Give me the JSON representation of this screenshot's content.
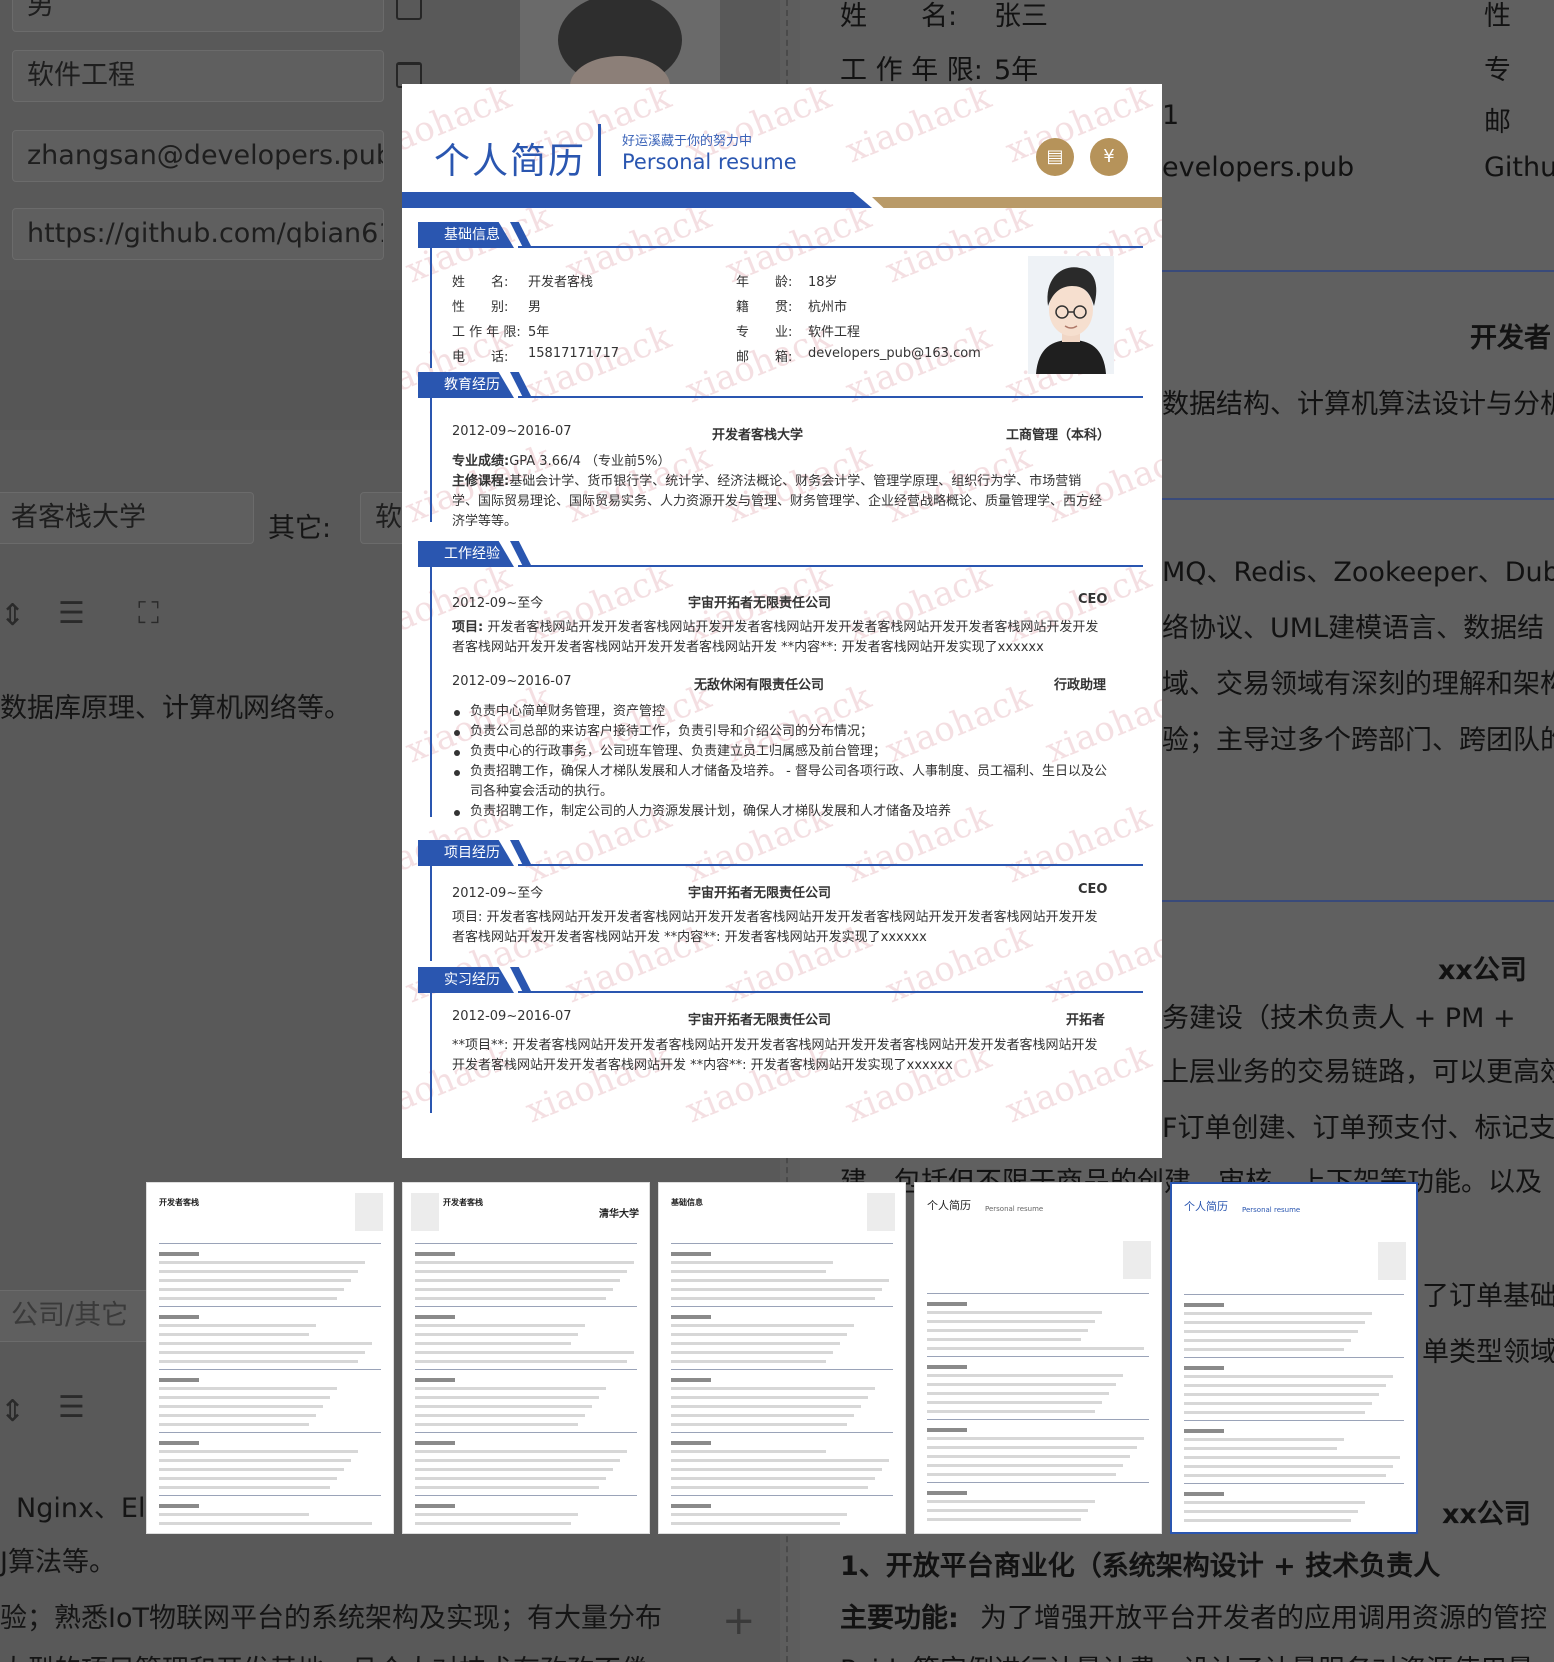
{
  "left_form": {
    "fields": [
      {
        "value": "男"
      },
      {
        "value": "软件工程"
      },
      {
        "value": "zhangsan@developers.pub"
      },
      {
        "value": "https://github.com/qbian61"
      }
    ],
    "school_value": "者客栈大学",
    "other_label": "其它:",
    "other_value": "软",
    "text_1": "数据库原理、计算机网络等。",
    "placeholder_company": "公司/其它",
    "text_2": "Nginx、Ela",
    "text_3": "J算法等。",
    "text_4": "验；熟悉IoT物联网平台的系统架构及实现；有大量分布",
    "text_5": "大型的项目管理和开发基地，且个人对技术有孜孜不倦",
    "plus": "+"
  },
  "right_preview": {
    "name_label": "姓　　名:",
    "name_value": "张三",
    "years_label": "工 作 年 限:",
    "years_value": "5年",
    "gender_label": "性",
    "major_label": "专",
    "email_label": "邮",
    "github_label": "Githu",
    "digit": "1",
    "email_value": "evelopers.pub",
    "heading": "开发者",
    "skill_1": "数据结构、计算机算法设计与分析",
    "skill_2": "MQ、Redis、Zookeeper、Dub",
    "skill_3": "络协议、UML建模语言、数据结",
    "skill_4": "域、交易领域有深刻的理解和架构",
    "skill_5": "验；主导过多个跨部门、跨团队的",
    "company_1": "xx公司",
    "proj_1": "务建设（技术负责人 + PM +",
    "proj_1_d1": "上层业务的交易链路，可以更高效",
    "proj_1_d2": "F订单创建、订单预支付、标记支",
    "proj_1_d3": "建，包括但不限于商品的创建、审核、上下架等功能。以及",
    "proj_1_d4": "了订单基础",
    "proj_1_d5": "单类型领域",
    "company_2": "xx公司",
    "proj_2": "1、开放平台商业化（系统架构设计 + 技术负责人",
    "proj_2_label": "主要功能:",
    "proj_2_d1": "为了增强开放平台开发者的应用调用资源的管控",
    "proj_2_d2": "Paide等实例进行计量计费，设计了计量服务对资源使用量"
  },
  "resume": {
    "title": "个人简历",
    "slogan": "好运溪藏于你的努力中",
    "subtitle": "Personal resume",
    "icons": [
      "save-icon",
      "coin-icon"
    ],
    "watermark": "xiaohack",
    "colors": {
      "accent": "#2a56b0",
      "gold": "#b99a68"
    },
    "basic": {
      "section": "基础信息",
      "rows": [
        {
          "l1": "姓　　名:",
          "v1": "开发者客栈",
          "l2": "年　　龄:",
          "v2": "18岁"
        },
        {
          "l1": "性　　别:",
          "v1": "男",
          "l2": "籍　　贯:",
          "v2": "杭州市"
        },
        {
          "l1": "工 作 年 限:",
          "v1": "5年",
          "l2": "专　　业:",
          "v2": "软件工程"
        },
        {
          "l1": "电　　话:",
          "v1": "15817171717",
          "l2": "邮　　箱:",
          "v2": "developers_pub@163.com"
        }
      ]
    },
    "education": {
      "section": "教育经历",
      "date": "2012-09~2016-07",
      "school": "开发者客栈大学",
      "major": "工商管理（本科）",
      "gpa_label": "专业成绩:",
      "gpa": "GPA 3.66/4 （专业前5%）",
      "courses_label": "主修课程:",
      "courses": "基础会计学、货币银行学、统计学、经济法概论、财务会计学、管理学原理、组织行为学、市场营销学、国际贸易理论、国际贸易实务、人力资源开发与管理、财务管理学、企业经营战略概论、质量管理学、西方经济学等等。"
    },
    "work": {
      "section": "工作经验",
      "jobs": [
        {
          "date": "2012-09~至今",
          "company": "宇宙开拓者无限责任公司",
          "role": "CEO",
          "label": "项目:",
          "desc": "开发者客栈网站开发开发者客栈网站开发开发者客栈网站开发开发者客栈网站开发开发者客栈网站开发开发者客栈网站开发开发者客栈网站开发开发者客栈网站开发 **内容**: 开发者客栈网站开发实现了xxxxxx"
        },
        {
          "date": "2012-09~2016-07",
          "company": "无敌休闲有限责任公司",
          "role": "行政助理",
          "bullets": [
            "负责中心简单财务管理，资产管控",
            "负责公司总部的来访客户接待工作，负责引导和介绍公司的分布情况；",
            "负责中心的行政事务，公司班车管理、负责建立员工归属感及前台管理；",
            "负责招聘工作，确保人才梯队发展和人才储备及培养。 - 督导公司各项行政、人事制度、员工福利、生日以及公司各种宴会活动的执行。",
            "负责招聘工作，制定公司的人力资源发展计划，确保人才梯队发展和人才储备及培养"
          ]
        }
      ]
    },
    "projects": {
      "section": "项目经历",
      "date": "2012-09~至今",
      "company": "宇宙开拓者无限责任公司",
      "role": "CEO",
      "desc": "项目: 开发者客栈网站开发开发者客栈网站开发开发者客栈网站开发开发者客栈网站开发开发者客栈网站开发开发者客栈网站开发开发者客栈网站开发 **内容**: 开发者客栈网站开发实现了xxxxxx"
    },
    "internship": {
      "section": "实习经历",
      "date": "2012-09~2016-07",
      "company": "宇宙开拓者无限责任公司",
      "role": "开拓者",
      "desc": "**项目**: 开发者客栈网站开发开发者客栈网站开发开发者客栈网站开发开发者客栈网站开发开发者客栈网站开发开发者客栈网站开发开发者客栈网站开发 **内容**: 开发者客栈网站开发实现了xxxxxx"
    }
  },
  "thumbnails": [
    {
      "name": "开发者客栈"
    },
    {
      "name": "开发者客栈",
      "school_logo": "清华大学"
    },
    {
      "name": "基础信息"
    },
    {
      "name": "个人简历",
      "subtitle": "Personal resume"
    },
    {
      "name": "个人简历",
      "subtitle": "Personal resume"
    }
  ]
}
